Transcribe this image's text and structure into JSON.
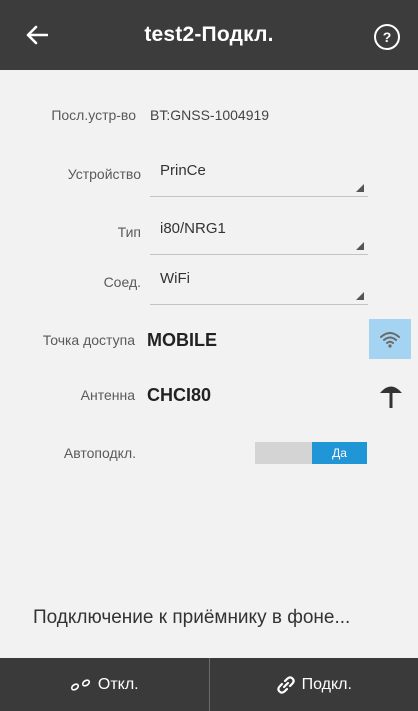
{
  "header": {
    "title": "test2-Подкл.",
    "help_label": "?"
  },
  "form": {
    "last_device": {
      "label": "Посл.устр-во",
      "value": "BT:GNSS-1004919"
    },
    "device": {
      "label": "Устройство",
      "value": "PrinCe"
    },
    "type": {
      "label": "Тип",
      "value": "i80/NRG1"
    },
    "connection": {
      "label": "Соед.",
      "value": "WiFi"
    },
    "access_point": {
      "label": "Точка доступа",
      "value": "MOBILE"
    },
    "antenna": {
      "label": "Антенна",
      "value": "CHCI80"
    },
    "autoconnect": {
      "label": "Автоподкл.",
      "value": "Да",
      "on": true
    }
  },
  "status": "Подключение к приёмнику в фоне...",
  "bottom": {
    "disconnect_label": "Откл.",
    "connect_label": "Подкл."
  },
  "colors": {
    "header_bg": "#3c3c3c",
    "accent": "#2196d6",
    "wifi_highlight": "#a5d3f2"
  }
}
